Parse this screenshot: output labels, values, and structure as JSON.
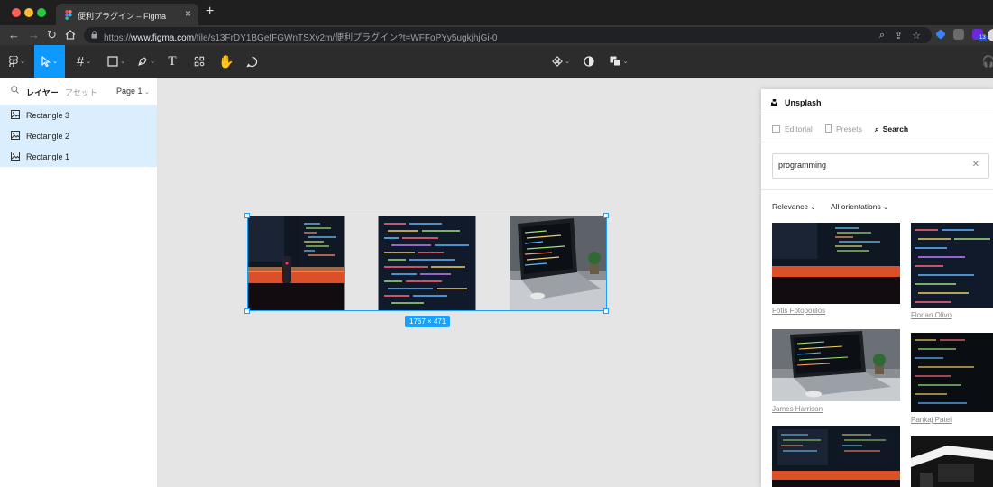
{
  "browser": {
    "tab_title": "便利プラグイン – Figma",
    "url_prefix": "https://",
    "url_host": "www.figma.com",
    "url_path": "/file/s13FrDY1BGefFGWnTSXv2m/便利プラグイン?t=WFFoPYy5ugkjhjGi-0",
    "extension_badge": "13",
    "colors": {
      "tab_bar": "#1f1f1f",
      "address_bar": "#353535"
    }
  },
  "toolbar": {
    "tools": [
      "main-menu",
      "move",
      "frame",
      "shape",
      "pen",
      "text",
      "resources",
      "hand",
      "comment"
    ],
    "active_tool": "move",
    "accent": "#0d99ff"
  },
  "left_panel": {
    "tab_layers": "レイヤー",
    "tab_assets": "アセット",
    "page_label": "Page 1",
    "layers": [
      {
        "name": "Rectangle 3"
      },
      {
        "name": "Rectangle 2"
      },
      {
        "name": "Rectangle 1"
      }
    ]
  },
  "canvas": {
    "selection_size": "1767 × 471",
    "selection_color": "#18a0fb"
  },
  "plugin": {
    "name": "Unsplash",
    "tabs": [
      {
        "label": "Editorial",
        "active": false
      },
      {
        "label": "Presets",
        "active": false
      },
      {
        "label": "Search",
        "active": true
      }
    ],
    "search": {
      "value": "programming",
      "placeholder": ""
    },
    "filter_relevance": "Relevance",
    "filter_orientation": "All orientations",
    "results": [
      {
        "author": "Fotis Fotopoulos",
        "subject": "code-desk-neon"
      },
      {
        "author": "Florian Olivo",
        "subject": "code-screen"
      },
      {
        "author": "James Harrison",
        "subject": "laptop-code"
      },
      {
        "author": "Pankaj Patel",
        "subject": "code-screen-dark"
      },
      {
        "author": "",
        "subject": "code-desk-neon"
      },
      {
        "author": "",
        "subject": "desk-setup"
      }
    ]
  }
}
